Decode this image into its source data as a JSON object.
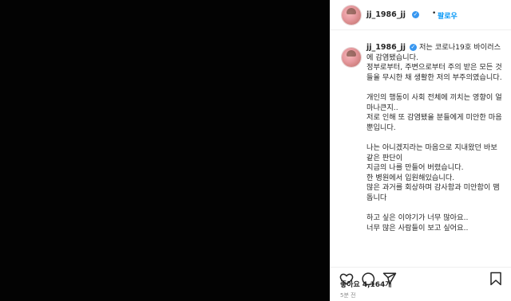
{
  "post": {
    "username": "jj_1986_jj",
    "follow_separator": "•",
    "follow_label": "팔로우"
  },
  "caption": {
    "line1": "저는 코로나19호 바이러스에 감염됐습니다.",
    "para1": "정부로부터, 주변으로부터 주의 받은 모든 것들을 무시한 채 생활한 저의 부주의였습니다.",
    "para2": "개인의 행동이 사회 전체에 끼치는 영향이 얼마나큰지..\n저로 인해 또 감염됐을 분들에게 미안한 마음뿐입니다.",
    "para3": "나는 아니겠지라는 마음으로 지내왔던 바보 같은 판단이\n지금의 나를 만들어 버렸습니다.\n한 병원에서 입원해있습니다.\n많은 과거를 회상하며 감사함과 미안함이 맴돕니다",
    "para4": "하고 싶은 이야기가 너무 많아요..\n너무 많은 사람들이 보고 싶어요.."
  },
  "stats": {
    "likes_label": "좋아요",
    "likes_count": "4,164개",
    "time_ago": "5분 전"
  },
  "icons": {
    "heart": "heart-icon",
    "comment": "comment-icon",
    "share": "share-icon",
    "save": "bookmark-icon"
  },
  "colors": {
    "media_bg": "#030303",
    "link": "#0095f6",
    "verified": "#3897f0"
  }
}
